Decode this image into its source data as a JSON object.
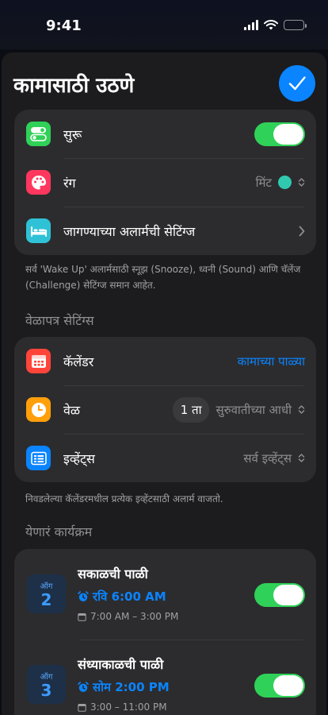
{
  "status": {
    "time": "9:41"
  },
  "sheet": {
    "title": "कामासाठी उठणे"
  },
  "settings": {
    "enabled_label": "सुरू",
    "enabled_on": true,
    "color_label": "रंग",
    "color_value": "मिंट",
    "color_hex": "#30c9b0",
    "wake_settings_label": "जागण्याच्या अलार्मची सेटिंग्ज",
    "footnote": "सर्व 'Wake Up' अलार्मसाठी स्नूझ (Snooze), ध्वनी (Sound) आणि चॅलेंज (Challenge) सेटिंग्ज समान आहेत."
  },
  "schedule": {
    "header": "वेळापत्र सेटिंग्स",
    "calendar_label": "कॅलेंडर",
    "calendar_value": "कामाच्या पाळ्या",
    "time_label": "वेळ",
    "time_offset": "1 ता",
    "time_relation": "सुरुवातीच्या आधी",
    "events_label": "इव्हेंट्स",
    "events_value": "सर्व इव्हेंट्स",
    "footnote": "निवडलेल्या कॅलेंडरमधील प्रत्येक इव्हेंटसाठी अलार्म वाजतो."
  },
  "upcoming": {
    "header": "येणारं कार्यक्रम",
    "events": [
      {
        "month": "ऑग",
        "day": "2",
        "title": "सकाळची पाळी",
        "alarm": "रवि 6:00 AM",
        "span": "7:00 AM – 3:00 PM",
        "enabled": true
      },
      {
        "month": "ऑग",
        "day": "3",
        "title": "संध्याकाळची पाळी",
        "alarm": "सोम 2:00 PM",
        "span": "3:00 – 11:00 PM",
        "enabled": true
      }
    ]
  },
  "colors": {
    "accent": "#0a84ff",
    "toggle_on": "#30d158",
    "card": "#2c2c2e",
    "sheet": "#1c1c1e"
  }
}
